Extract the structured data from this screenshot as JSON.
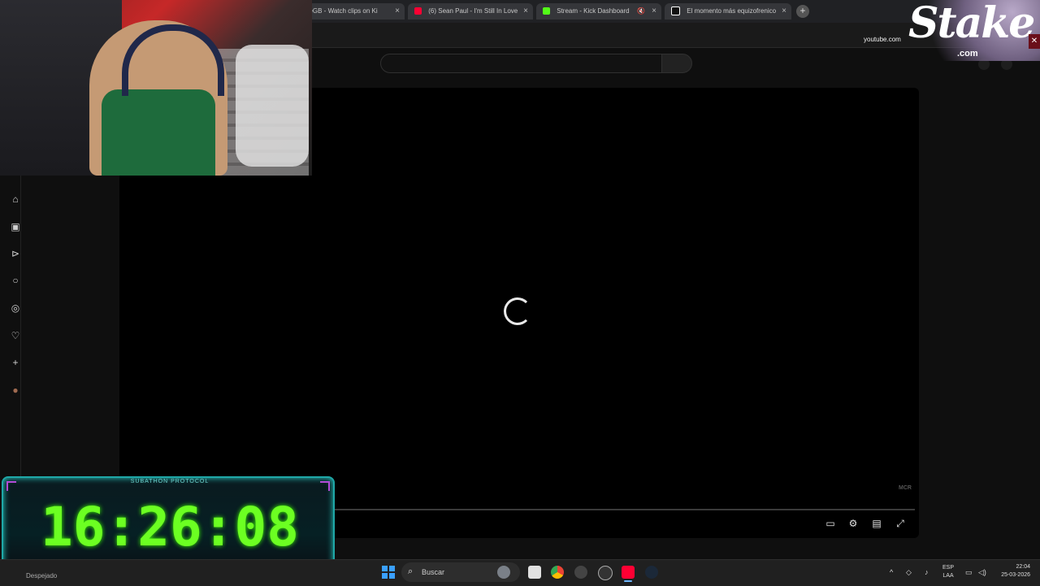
{
  "browser": {
    "tabs": [
      {
        "title": "eeGB - Watch clips on Ki",
        "icon_color": "#53fc18"
      },
      {
        "title": "(6) Sean Paul - I'm Still In Love",
        "icon_color": "#ff0033"
      },
      {
        "title": "Stream - Kick Dashboard",
        "icon_color": "#53fc18"
      },
      {
        "title": "El momento más equizofrenico",
        "icon_color": "#ffffff"
      }
    ],
    "close_glyph": "×",
    "new_tab_glyph": "+",
    "site_host": "youtube.com"
  },
  "stake": {
    "word": "Stake",
    "sub": ".com"
  },
  "sidebar": {
    "icons": [
      "home-icon",
      "shorts-icon",
      "filter-icon",
      "search-icon",
      "explore-icon",
      "heart-icon",
      "add-icon",
      "avatar-icon"
    ]
  },
  "player": {
    "watermark": "MCR",
    "controls": [
      "subtitles-icon",
      "settings-icon",
      "miniplayer-icon",
      "fullscreen-icon"
    ]
  },
  "timer": {
    "label": "SUBATHON PROTOCOL",
    "value": "16:26:08"
  },
  "taskbar": {
    "weather": "Despejado",
    "search_placeholder": "Buscar",
    "lang_top": "ESP",
    "lang_bottom": "LAA",
    "time": "22:04",
    "date": "25-03-2026"
  }
}
